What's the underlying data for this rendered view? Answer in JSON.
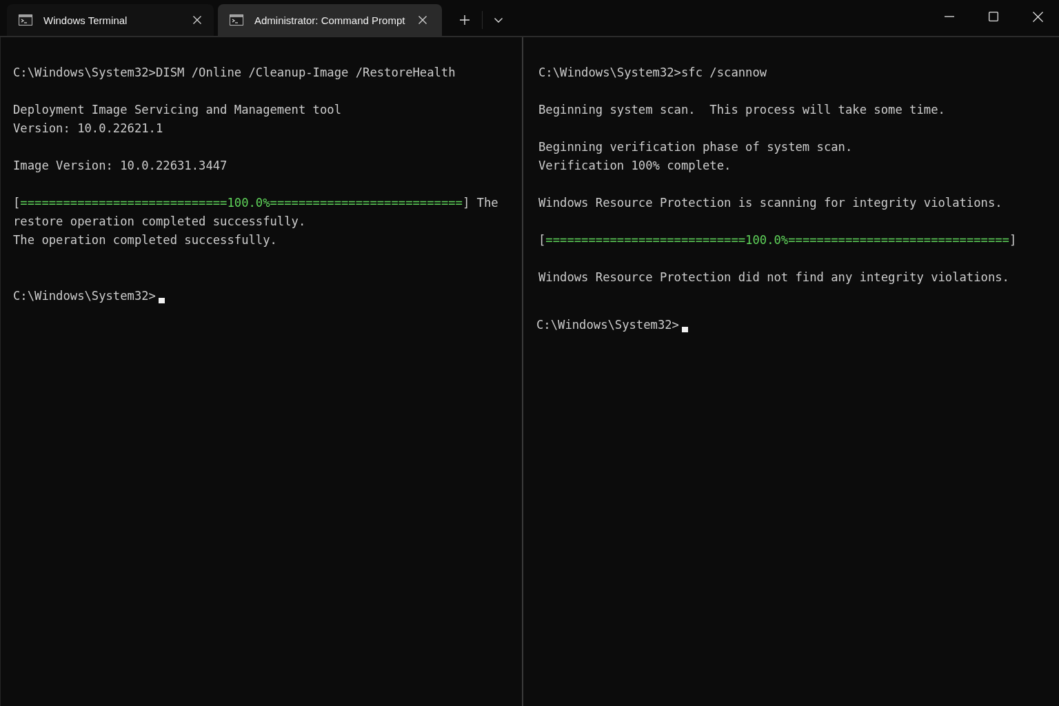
{
  "tabs": [
    {
      "title": "Windows Terminal",
      "selected": false
    },
    {
      "title": "Administrator: Command Prompt",
      "selected": true
    }
  ],
  "panes": [
    {
      "blocks": [
        {
          "lines": [
            {
              "kind": "text",
              "text": "C:\\Windows\\System32>DISM /Online /Cleanup-Image /RestoreHealth"
            }
          ]
        },
        {
          "lines": [
            {
              "kind": "text",
              "text": "Deployment Image Servicing and Management tool"
            },
            {
              "kind": "text",
              "text": "Version: 10.0.22621.1"
            }
          ]
        },
        {
          "lines": [
            {
              "kind": "text",
              "text": "Image Version: 10.0.22631.3447"
            }
          ]
        },
        {
          "lines": [
            {
              "kind": "progress",
              "open": "[",
              "bar": "=============================100.0%===========================",
              "close": "] The"
            },
            {
              "kind": "text",
              "text": "restore operation completed successfully."
            },
            {
              "kind": "text",
              "text": "The operation completed successfully."
            }
          ]
        }
      ],
      "prompt": {
        "text": "C:\\Windows\\System32>",
        "cursor": true
      }
    },
    {
      "blocks": [
        {
          "lines": [
            {
              "kind": "text",
              "text": "C:\\Windows\\System32>sfc /scannow"
            }
          ]
        },
        {
          "lines": [
            {
              "kind": "text",
              "text": "Beginning system scan.  This process will take some time."
            }
          ]
        },
        {
          "lines": [
            {
              "kind": "text",
              "text": "Beginning verification phase of system scan."
            },
            {
              "kind": "text",
              "text": "Verification 100% complete."
            }
          ]
        },
        {
          "lines": [
            {
              "kind": "text",
              "text": "Windows Resource Protection is scanning for integrity violations."
            }
          ]
        },
        {
          "lines": [
            {
              "kind": "progress",
              "open": "[",
              "bar": "============================100.0%===============================",
              "close": "]"
            }
          ]
        },
        {
          "lines": [
            {
              "kind": "text",
              "text": "Windows Resource Protection did not find any integrity violations."
            }
          ]
        }
      ],
      "prompt": {
        "text": "C:\\Windows\\System32>",
        "cursor": true
      }
    }
  ]
}
